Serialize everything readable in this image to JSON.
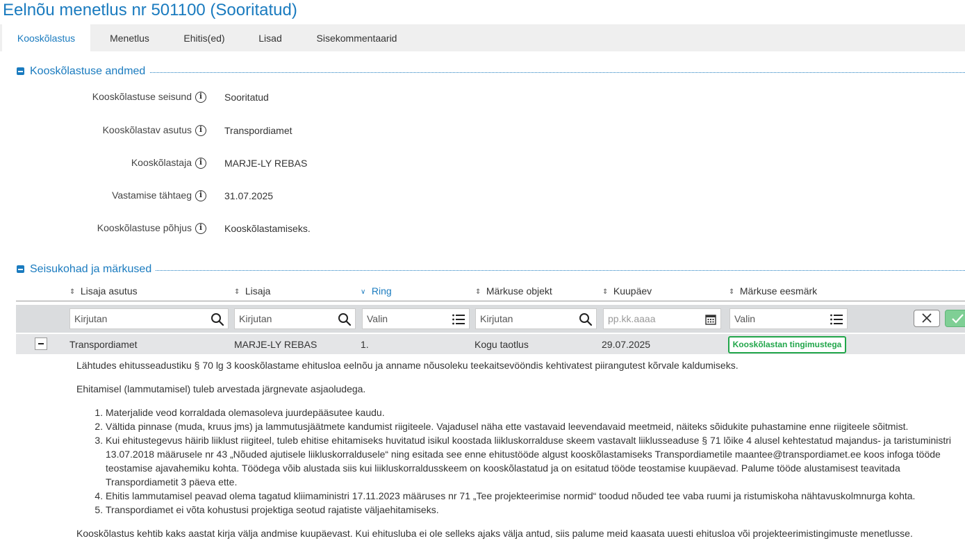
{
  "page_title": "Eelnõu menetlus nr 501100 (Sooritatud)",
  "tabs": [
    "Kooskõlastus",
    "Menetlus",
    "Ehitis(ed)",
    "Lisad",
    "Sisekommentaarid"
  ],
  "section1": {
    "title": "Kooskõlastuse andmed",
    "fields": [
      {
        "label": "Kooskõlastuse seisund",
        "value": "Sooritatud"
      },
      {
        "label": "Kooskõlastav asutus",
        "value": "Transpordiamet"
      },
      {
        "label": "Kooskõlastaja",
        "value": "MARJE-LY REBAS"
      },
      {
        "label": "Vastamise tähtaeg",
        "value": "31.07.2025"
      },
      {
        "label": "Kooskõlastuse põhjus",
        "value": "Kooskõlastamiseks."
      }
    ]
  },
  "section2": {
    "title": "Seisukohad ja märkused",
    "columns": [
      "Lisaja asutus",
      "Lisaja",
      "Ring",
      "Märkuse objekt",
      "Kuupäev",
      "Märkuse eesmärk"
    ],
    "filters": {
      "lisaja_asutus": "Kirjutan",
      "lisaja": "Kirjutan",
      "ring": "Valin",
      "objekt": "Kirjutan",
      "kuupaev": "pp.kk.aaaa",
      "eesmark": "Valin"
    },
    "row": {
      "lisaja_asutus": "Transpordiamet",
      "lisaja": "MARJE-LY REBAS",
      "ring": "1.",
      "objekt": "Kogu taotlus",
      "kuupaev": "29.07.2025",
      "eesmark": "Kooskõlastan tingimustega"
    },
    "detail": {
      "intro": "Lähtudes ehitusseadustiku § 70 lg 3 kooskõlastame ehitusloa eelnõu ja anname nõusoleku teekaitsevööndis kehtivatest piirangutest kõrvale kaldumiseks.",
      "lead": "Ehitamisel (lammutamisel) tuleb arvestada järgnevate asjaoludega.",
      "items": [
        "Materjalide veod korraldada olemasoleva juurdepääsutee kaudu.",
        "Vältida pinnase (muda, kruus jms) ja lammutusjäätmete kandumist riigiteele. Vajadusel näha ette vastavaid leevendavaid meetmeid, näiteks sõidukite puhastamine enne riigiteele sõitmist.",
        "Kui ehitustegevus häirib liiklust riigiteel, tuleb ehitise ehitamiseks huvitatud isikul koostada liikluskorralduse skeem vastavalt liiklusseaduse § 71 lõike 4 alusel kehtestatud majandus- ja taristuministri 13.07.2018 määrusele nr 43 „Nõuded ajutisele liikluskorraldusele“ ning esitada see enne ehitustööde algust kooskõlastamiseks Transpordiametile maantee@transpordiamet.ee koos infoga tööde teostamise ajavahemiku kohta. Töödega võib alustada siis kui liikluskorraldusskeem on kooskõlastatud ja on esitatud tööde teostamise kuupäevad. Palume tööde alustamisest teavitada Transpordiametit 3 päeva ette.",
        "Ehitis lammutamisel peavad olema tagatud kliimaministri 17.11.2023 määruses nr 71 „Tee projekteerimise normid“ toodud nõuded tee vaba ruumi ja ristumiskoha nähtavuskolmnurga kohta.",
        "Transpordiamet ei võta kohustusi projektiga seotud rajatiste väljaehitamiseks."
      ],
      "outro": "Kooskõlastus kehtib kaks aastat kirja välja andmise kuupäevast. Kui ehitusluba ei ole selleks ajaks välja antud, siis palume meid kaasata uuesti ehitusloa või projekteerimistingimuste menetlusse."
    }
  },
  "colors": {
    "accent": "#1a7bbf",
    "success": "#21a64a"
  }
}
